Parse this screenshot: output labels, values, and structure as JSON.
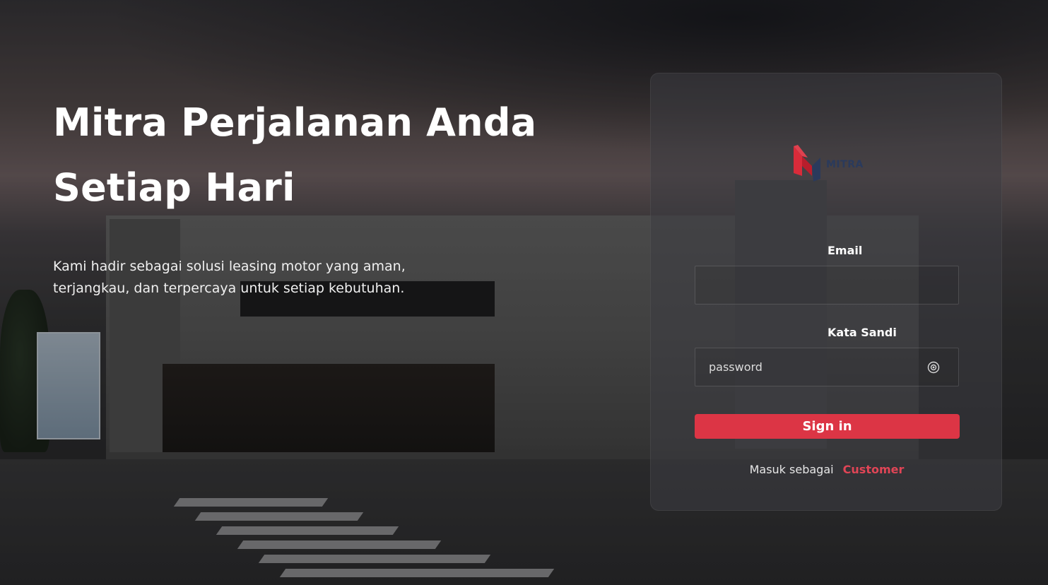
{
  "hero": {
    "title_line1": "Mitra Perjalanan Anda",
    "title_line2": "Setiap Hari",
    "subtitle": "Kami hadir sebagai solusi leasing motor yang aman, terjangkau, dan terpercaya untuk setiap kebutuhan."
  },
  "login": {
    "logo_text": "MITRA",
    "email_label": "Email",
    "email_value": "",
    "email_placeholder": "",
    "password_label": "Kata Sandi",
    "password_value": "",
    "password_placeholder": "password",
    "password_toggle_icon": "eye-icon",
    "signin_label": "Sign in",
    "switch_prefix": "Masuk sebagai",
    "switch_link": "Customer"
  },
  "colors": {
    "accent": "#dc3545",
    "link": "#e04556",
    "logo_red": "#d92b3a",
    "logo_navy": "#2a3a5c"
  }
}
